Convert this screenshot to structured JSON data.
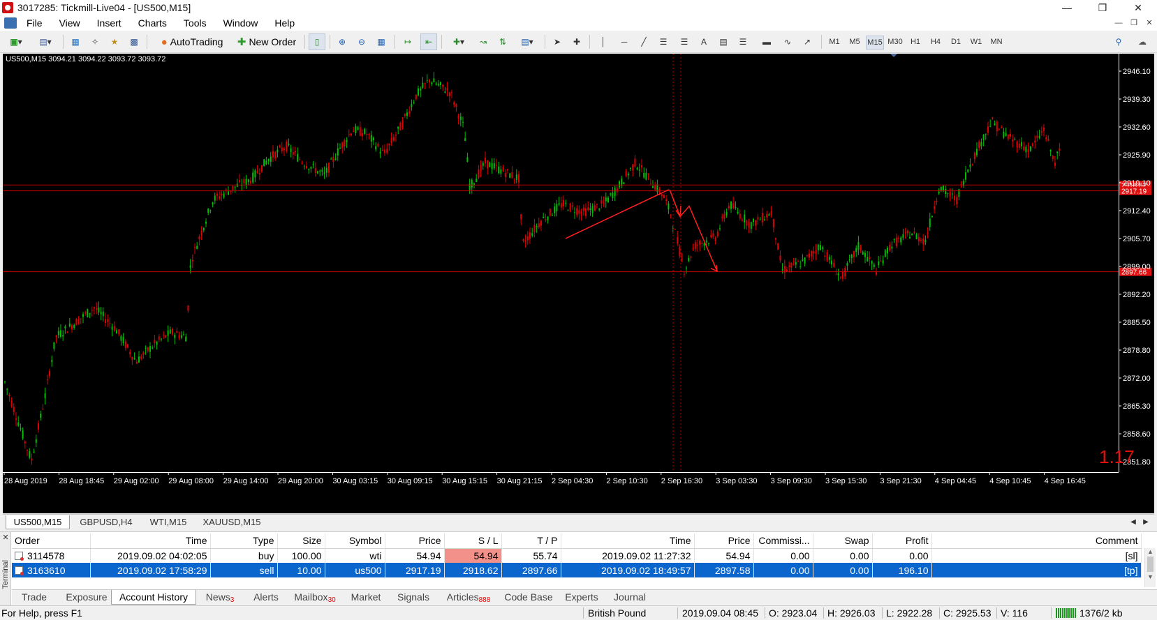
{
  "window": {
    "title": "3017285: Tickmill-Live04 - [US500,M15]"
  },
  "menu": {
    "items": [
      "File",
      "View",
      "Insert",
      "Charts",
      "Tools",
      "Window",
      "Help"
    ]
  },
  "toolbar": {
    "autotrading_label": "AutoTrading",
    "new_order_label": "New Order",
    "timeframes": [
      "M1",
      "M5",
      "M15",
      "M30",
      "H1",
      "H4",
      "D1",
      "W1",
      "MN"
    ],
    "selected_timeframe": "M15"
  },
  "chart": {
    "header": "US500,M15  3094.21 3094.22 3093.72 3093.72",
    "price_labels": [
      "2946.10",
      "2939.30",
      "2932.60",
      "2925.90",
      "2919.10",
      "2912.40",
      "2905.70",
      "2899.00",
      "2892.20",
      "2885.50",
      "2878.80",
      "2872.00",
      "2865.30",
      "2858.60",
      "2851.80"
    ],
    "time_labels": [
      "28 Aug 2019",
      "28 Aug 18:45",
      "29 Aug 02:00",
      "29 Aug 08:00",
      "29 Aug 14:00",
      "29 Aug 20:00",
      "30 Aug 03:15",
      "30 Aug 09:15",
      "30 Aug 15:15",
      "30 Aug 21:15",
      "2 Sep 04:30",
      "2 Sep 10:30",
      "2 Sep 16:30",
      "3 Sep 03:30",
      "3 Sep 09:30",
      "3 Sep 15:30",
      "3 Sep 21:30",
      "4 Sep 04:45",
      "4 Sep 10:45",
      "4 Sep 16:45"
    ],
    "level_labels": {
      "upper_a": "2918.62",
      "upper_b": "2917.19",
      "lower": "2897.66"
    },
    "corner_value": "1.17",
    "colors": {
      "bull": "#00c000",
      "bear": "#e00000",
      "level": "#c00000",
      "arrow": "#ff2020"
    }
  },
  "chart_tabs": [
    "US500,M15",
    "GBPUSD,H4",
    "WTI,M15",
    "XAUUSD,M15"
  ],
  "terminal": {
    "side_label": "Terminal",
    "columns": [
      "Order",
      "Time",
      "Type",
      "Size",
      "Symbol",
      "Price",
      "S / L",
      "T / P",
      "Time",
      "Price",
      "Commissi...",
      "Swap",
      "Profit",
      "Comment"
    ],
    "rows": [
      [
        "3114578",
        "2019.09.02 04:02:05",
        "buy",
        "100.00",
        "wti",
        "54.94",
        "54.94",
        "55.74",
        "2019.09.02 11:27:32",
        "54.94",
        "0.00",
        "0.00",
        "0.00",
        "[sl]"
      ],
      [
        "3163610",
        "2019.09.02 17:58:29",
        "sell",
        "10.00",
        "us500",
        "2917.19",
        "2918.62",
        "2897.66",
        "2019.09.02 18:49:57",
        "2897.58",
        "0.00",
        "0.00",
        "196.10",
        "[tp]"
      ]
    ],
    "tabs": [
      {
        "label": "Trade",
        "badge": ""
      },
      {
        "label": "Exposure",
        "badge": ""
      },
      {
        "label": "Account History",
        "badge": ""
      },
      {
        "label": "News",
        "badge": "3"
      },
      {
        "label": "Alerts",
        "badge": ""
      },
      {
        "label": "Mailbox",
        "badge": "30"
      },
      {
        "label": "Market",
        "badge": ""
      },
      {
        "label": "Signals",
        "badge": ""
      },
      {
        "label": "Articles",
        "badge": "888"
      },
      {
        "label": "Code Base",
        "badge": ""
      },
      {
        "label": "Experts",
        "badge": ""
      },
      {
        "label": "Journal",
        "badge": ""
      }
    ]
  },
  "status": {
    "help": "For Help, press F1",
    "profile": "British Pound",
    "datetime": "2019.09.04 08:45",
    "open": "O: 2923.04",
    "high": "H: 2926.03",
    "low": "L: 2922.28",
    "close": "C: 2925.53",
    "volume": "V: 116",
    "traffic": "1376/2 kb"
  }
}
